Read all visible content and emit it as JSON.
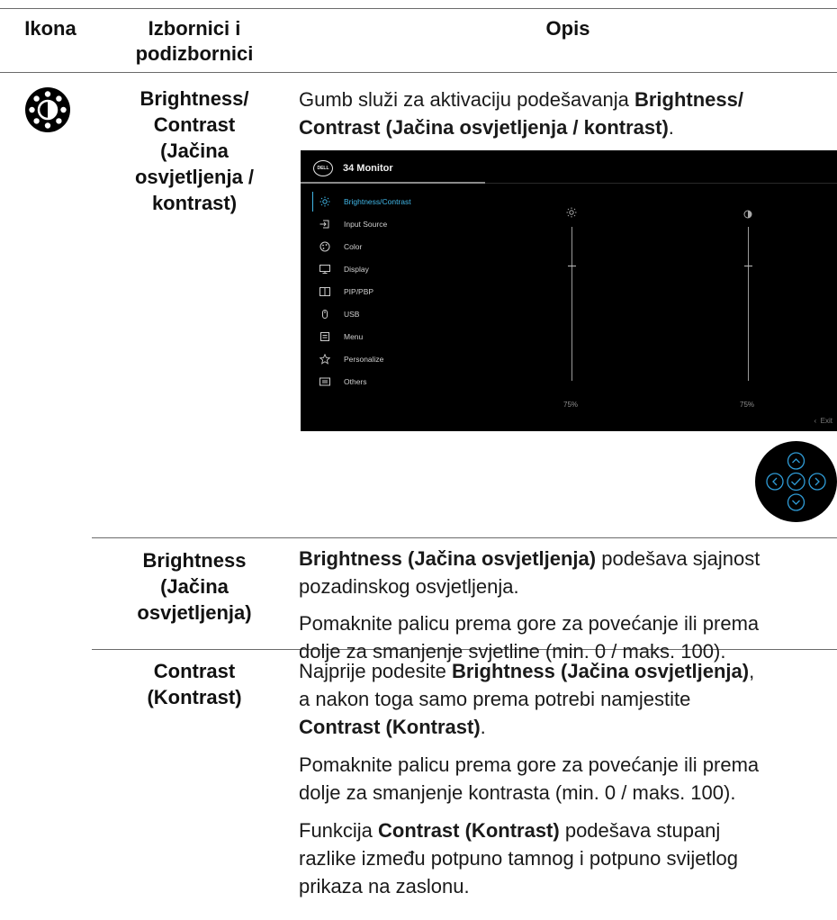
{
  "header": {
    "col1": "Ikona",
    "col2_line1": "Izbornici i",
    "col2_line2": "podizbornici",
    "col3": "Opis"
  },
  "row_brightness_contrast": {
    "icon": "brightness-contrast-icon",
    "menu_lines": [
      "Brightness/",
      "Contrast",
      "(Jačina",
      "osvjetljenja /",
      "kontrast)"
    ],
    "desc_pre": "Gumb služi za aktivaciju podešavanja ",
    "desc_bold1": "Brightness/",
    "desc_bold2": "Contrast (Jačina osvjetljenja / kontrast)",
    "desc_post": "."
  },
  "osd": {
    "logo": "DELL",
    "model": "34 Monitor",
    "menu_items": [
      {
        "label": "Brightness/Contrast",
        "icon": "brightness-icon",
        "active": true
      },
      {
        "label": "Input Source",
        "icon": "input-source-icon"
      },
      {
        "label": "Color",
        "icon": "color-palette-icon"
      },
      {
        "label": "Display",
        "icon": "display-icon"
      },
      {
        "label": "PIP/PBP",
        "icon": "pip-pbp-icon"
      },
      {
        "label": "USB",
        "icon": "usb-icon"
      },
      {
        "label": "Menu",
        "icon": "menu-icon"
      },
      {
        "label": "Personalize",
        "icon": "star-icon"
      },
      {
        "label": "Others",
        "icon": "others-icon"
      }
    ],
    "brightness_value": "75%",
    "contrast_value": "75%",
    "brightness_level": 0.75,
    "contrast_level": 0.75,
    "exit_label": "Exit",
    "accent_color": "#41b6e6"
  },
  "joystick": {
    "icons": [
      "up-arrow-icon",
      "left-arrow-icon",
      "ok-check-icon",
      "right-arrow-icon",
      "down-arrow-icon"
    ]
  },
  "row_brightness": {
    "menu_lines": [
      "Brightness",
      "(Jačina",
      "osvjetljenja)"
    ],
    "p1_bold": "Brightness (Jačina osvjetljenja)",
    "p1_rest_line1": " podešava sjajnost",
    "p1_line2": "pozadinskog osvjetljenja.",
    "p2_line1": "Pomaknite palicu prema gore za povećanje ili prema",
    "p2_line2": "dolje za smanjenje svjetline (min. 0 / maks. 100)."
  },
  "row_contrast": {
    "menu_lines": [
      "Contrast",
      "(Kontrast)"
    ],
    "p1_pre": "Najprije podesite ",
    "p1_bold": "Brightness (Jačina osvjetljenja)",
    "p1_post": ",",
    "p1_line2": "a nakon toga samo prema potrebi namjestite",
    "p1_bold2": "Contrast (Kontrast)",
    "p1_end": ".",
    "p2_line1": "Pomaknite palicu prema gore za povećanje ili prema",
    "p2_line2": "dolje za smanjenje kontrasta (min. 0 / maks. 100).",
    "p3_pre": "Funkcija ",
    "p3_bold": "Contrast (Kontrast)",
    "p3_rest": " podešava stupanj",
    "p3_line2": "razlike između potpuno tamnog i potpuno svijetlog",
    "p3_line3": "prikaza na zaslonu."
  }
}
